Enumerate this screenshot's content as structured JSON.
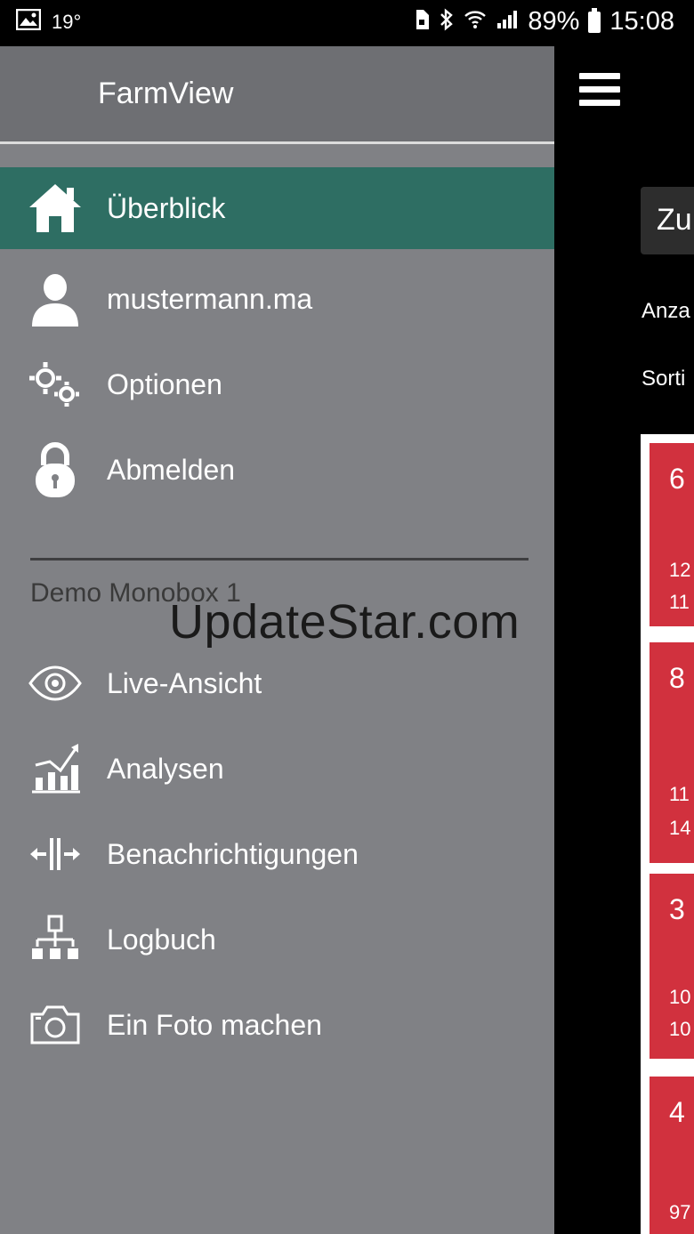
{
  "status_bar": {
    "temperature": "19°",
    "battery_percent": "89%",
    "time": "15:08"
  },
  "drawer": {
    "title": "FarmView",
    "items": [
      {
        "label": "Überblick",
        "icon": "home-icon",
        "active": true
      },
      {
        "label": "mustermann.ma",
        "icon": "user-icon"
      },
      {
        "label": "Optionen",
        "icon": "gears-icon"
      },
      {
        "label": "Abmelden",
        "icon": "lock-icon"
      }
    ],
    "section_title": "Demo Monobox 1",
    "section_items": [
      {
        "label": "Live-Ansicht",
        "icon": "eye-icon"
      },
      {
        "label": "Analysen",
        "icon": "chart-icon"
      },
      {
        "label": "Benachrichtigungen",
        "icon": "split-arrows-icon"
      },
      {
        "label": "Logbuch",
        "icon": "sitemap-icon"
      },
      {
        "label": "Ein Foto machen",
        "icon": "camera-icon"
      }
    ]
  },
  "main": {
    "button_label": "Zu",
    "label_1": "Anza",
    "label_2": "Sorti",
    "cards": [
      {
        "big": "6",
        "line1": "12",
        "line2": "11"
      },
      {
        "big": "8",
        "line1": "11",
        "line2": "14"
      },
      {
        "big": "3",
        "line1": "10",
        "line2": "10"
      },
      {
        "big": "4",
        "line1": "97"
      }
    ]
  },
  "watermark": "UpdateStar.com",
  "colors": {
    "drawer_bg": "#808185",
    "header_bg": "#6e6f73",
    "active_bg": "#2e6e63",
    "card_red": "#d1313e"
  }
}
